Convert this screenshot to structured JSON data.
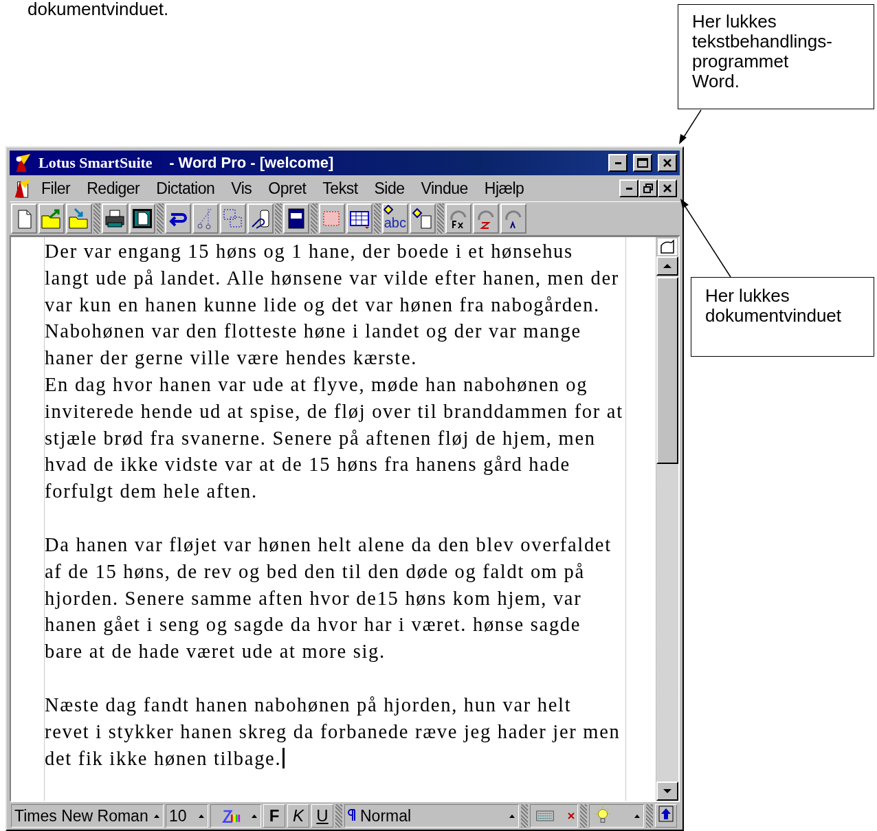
{
  "page_text": "dokumentvinduet.",
  "callouts": [
    {
      "lines": [
        "Her lukkes",
        "tekstbehandlings-",
        "programmet",
        "Word."
      ]
    },
    {
      "lines": [
        "Her lukkes",
        "dokumentvinduet"
      ]
    }
  ],
  "window": {
    "title_app": "Lotus SmartSuite",
    "title_doc": "- Word Pro - [welcome]",
    "menu": [
      "Filer",
      "Rediger",
      "Dictation",
      "Vis",
      "Opret",
      "Tekst",
      "Side",
      "Vindue",
      "Hjælp"
    ],
    "toolbar_text": "abc",
    "document": {
      "cursor_at_end": true,
      "sections": [
        {
          "paragraphs": [
            {
              "lines": [
                "Der var engang 15 høns og 1 hane, der boede i et hønsehus",
                "langt ude på landet. Alle hønsene var vilde efter hanen, men der",
                "var kun en hanen kunne lide og det var hønen fra nabogården.",
                "Nabohønen var den flotteste høne i landet og der var mange",
                "haner der gerne ville være hendes kærste."
              ]
            },
            {
              "lines": [
                "En dag hvor hanen var ude at flyve, møde han nabohønen og",
                "inviterede hende ud at spise, de fløj over til branddammen for at",
                "stjæle brød fra svanerne. Senere på aftenen fløj de hjem, men",
                "hvad de ikke vidste var at de 15 høns fra hanens gård hade",
                "forfulgt dem hele aften."
              ]
            }
          ]
        },
        {
          "paragraphs": [
            {
              "lines": [
                "Da hanen var fløjet var hønen helt alene da den blev overfaldet",
                "af de 15 høns, de rev og bed den til den døde og faldt om på",
                "hjorden. Senere samme aften hvor de15 høns kom hjem, var",
                "hanen gået i seng og sagde da hvor har i været. hønse sagde",
                "bare at de hade været ude at more sig."
              ]
            }
          ]
        },
        {
          "paragraphs": [
            {
              "lines": [
                "Næste dag fandt hanen nabohønen på hjorden, hun var helt",
                "revet i stykker hanen skreg da forbanede ræve jeg hader jer men",
                "det fik ikke hønen tilbage."
              ]
            }
          ]
        }
      ]
    },
    "status_bar": {
      "font": "Times New Roman",
      "size": "10",
      "bold": "F",
      "italic": "K",
      "underline": "U",
      "style": "Normal"
    }
  }
}
